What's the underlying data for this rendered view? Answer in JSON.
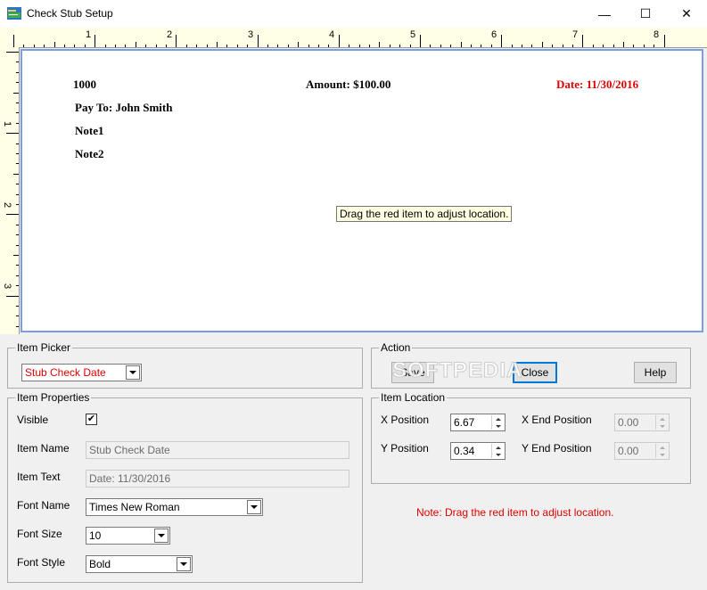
{
  "window": {
    "title": "Check Stub Setup",
    "minimize": "—",
    "maximize": "☐",
    "close": "✕"
  },
  "rulers": {
    "h_labels": [
      "1",
      "2",
      "3",
      "4",
      "5",
      "6",
      "7",
      "8"
    ],
    "v_labels": [
      "1",
      "2",
      "3"
    ]
  },
  "stub": {
    "check_number": "1000",
    "amount": "Amount: $100.00",
    "date": "Date: 11/30/2016",
    "pay_to": "Pay To: John Smith",
    "note1": "Note1",
    "note2": "Note2",
    "tooltip": "Drag the red item to adjust location.",
    "highlight_color": "#e00000"
  },
  "item_picker": {
    "title": "Item Picker",
    "selected": "Stub Check Date"
  },
  "action": {
    "title": "Action",
    "save": "Save",
    "close": "Close",
    "help": "Help"
  },
  "item_properties": {
    "title": "Item Properties",
    "visible_label": "Visible",
    "visible_checked": "✔",
    "item_name_label": "Item Name",
    "item_name_value": "Stub Check Date",
    "item_text_label": "Item Text",
    "item_text_value": "Date: 11/30/2016",
    "font_name_label": "Font Name",
    "font_name_value": "Times New Roman",
    "font_size_label": "Font Size",
    "font_size_value": "10",
    "font_style_label": "Font Style",
    "font_style_value": "Bold"
  },
  "item_location": {
    "title": "Item Location",
    "x_label": "X Position",
    "x_value": "6.67",
    "y_label": "Y Position",
    "y_value": "0.34",
    "x_end_label": "X End Position",
    "x_end_value": "0.00",
    "y_end_label": "Y End Position",
    "y_end_value": "0.00"
  },
  "note": "Note:  Drag the red item to adjust location.",
  "watermark": "SOFTPEDIA"
}
